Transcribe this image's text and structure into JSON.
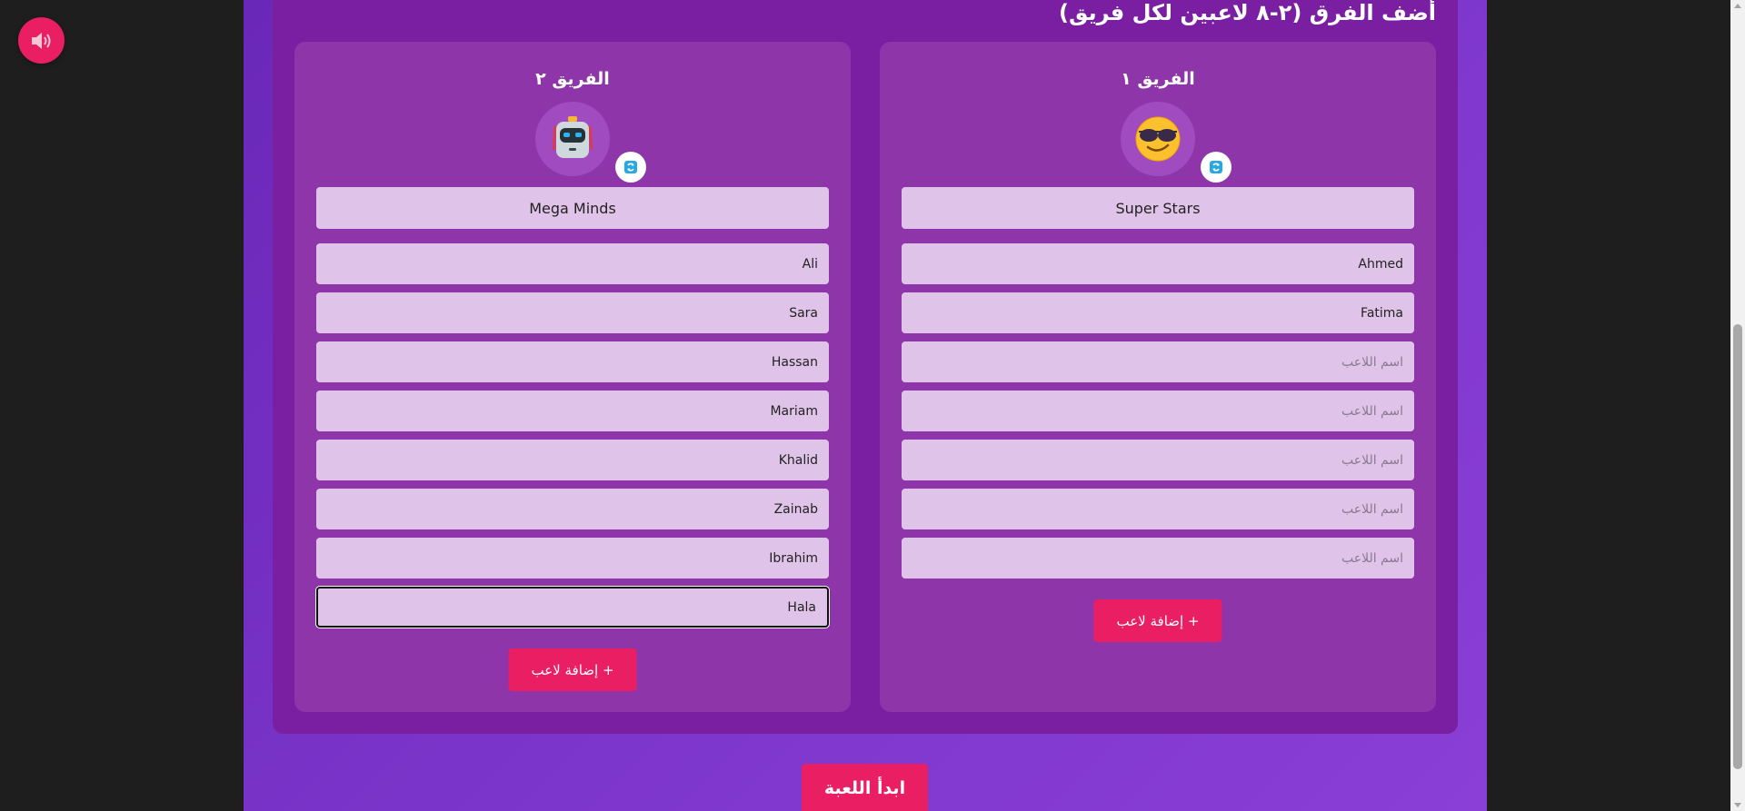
{
  "sound_button": {
    "icon": "speaker-icon",
    "muted": true
  },
  "setup": {
    "title": "أضف الفرق (٢-٨ لاعبين لكل فريق)",
    "teams": [
      {
        "title": "الفريق ١",
        "avatar_icon": "sunglasses-face-icon",
        "name": "Super Stars",
        "players": [
          "Ahmed",
          "Fatima",
          "",
          "",
          "",
          "",
          ""
        ],
        "player_placeholder": "اسم اللاعب",
        "add_player_label": "+ إضافة لاعب"
      },
      {
        "title": "الفريق ٢",
        "avatar_icon": "robot-icon",
        "name": "Mega Minds",
        "players": [
          "Ali",
          "Sara",
          "Hassan",
          "Mariam",
          "Khalid",
          "Zainab",
          "Ibrahim",
          "Hala"
        ],
        "player_placeholder": "اسم اللاعب",
        "add_player_label": "+ إضافة لاعب"
      }
    ],
    "start_label": "ابدأ اللعبة"
  },
  "colors": {
    "accent": "#e91e63",
    "panel": "#7b1fa2",
    "card": "#8e35aa",
    "input_bg": "#e0c3e8"
  }
}
